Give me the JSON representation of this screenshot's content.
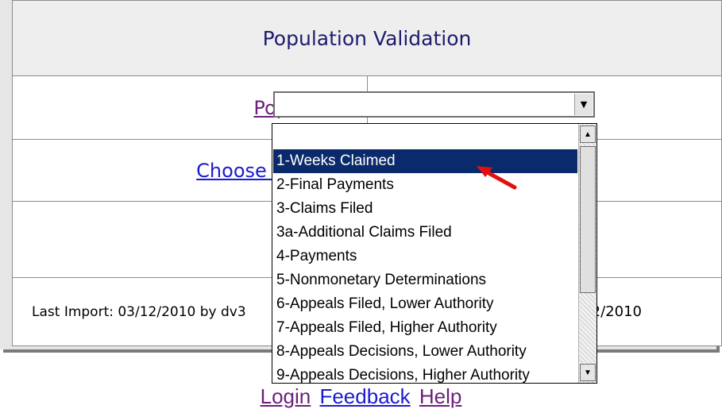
{
  "header": {
    "title": "Population Validation"
  },
  "form": {
    "population_label": "Population",
    "choose_function_label": "Choose Function",
    "population_value": ""
  },
  "footer": {
    "last_import": "Last Import: 03/12/2010 by dv3",
    "right_text": "2/2010"
  },
  "dropdown": {
    "options": [
      "",
      "1-Weeks Claimed",
      "2-Final Payments",
      "3-Claims Filed",
      "3a-Additional Claims Filed",
      "4-Payments",
      "5-Nonmonetary Determinations",
      "6-Appeals Filed, Lower Authority",
      "7-Appeals Filed, Higher Authority",
      "8-Appeals Decisions, Lower Authority",
      "9-Appeals Decisions, Higher Authority"
    ],
    "selected": "1-Weeks Claimed"
  },
  "links": {
    "login": "Login",
    "feedback": "Feedback",
    "help": "Help"
  },
  "icons": {
    "select_arrow": "chevron-down-icon",
    "annotation": "red-arrow-icon",
    "scroll_up": "scroll-up-icon",
    "scroll_down": "scroll-down-icon"
  },
  "colors": {
    "selected_bg": "#0b2a6b",
    "title": "#1c1c6e",
    "visited_link": "#6b1f7a",
    "link": "#1b1bd0",
    "annotation": "#e01010"
  }
}
